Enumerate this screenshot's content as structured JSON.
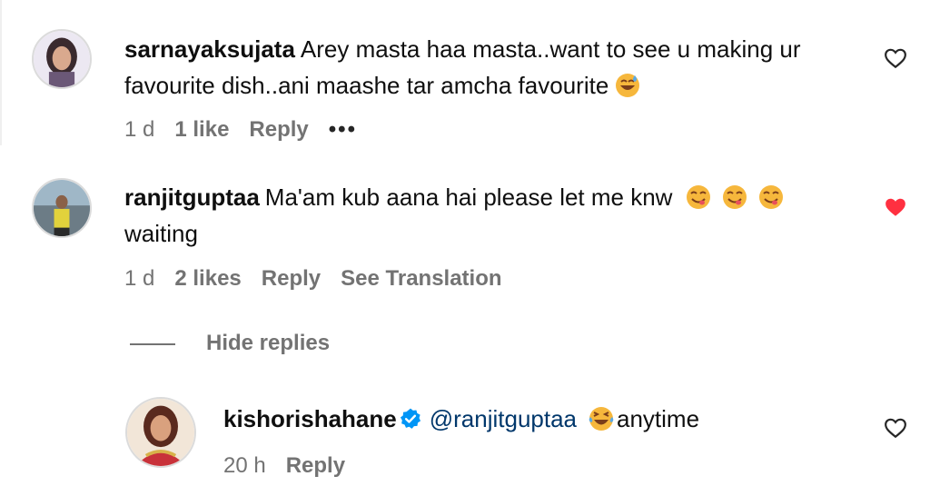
{
  "comments": [
    {
      "username": "sarnayaksujata",
      "text_line1": "Arey masta haa masta..want to see u making ur",
      "text_line2": "favourite dish..ani maashe tar amcha favourite",
      "emoji": "sweat-smile-emoji",
      "time": "1 d",
      "likes": "1 like",
      "reply": "Reply",
      "more": "•••",
      "liked": false
    },
    {
      "username": "ranjitguptaa",
      "text_line1": "Ma'am kub aana hai please let me knw",
      "text_line2": "waiting",
      "emoji": "yum-emoji",
      "time": "1 d",
      "likes": "2 likes",
      "reply": "Reply",
      "translate": "See Translation",
      "liked": true
    }
  ],
  "hide_replies_label": "Hide replies",
  "reply": {
    "username": "kishorishahane",
    "verified": true,
    "mention": "@ranjitguptaa",
    "emoji": "laughing-tears-emoji",
    "text": "anytime",
    "time": "20 h",
    "reply": "Reply",
    "liked": false
  },
  "colors": {
    "text": "#0f0f0f",
    "meta": "#737373",
    "mention": "#00376b",
    "heart_liked": "#ff3040",
    "verified": "#0095f6"
  }
}
